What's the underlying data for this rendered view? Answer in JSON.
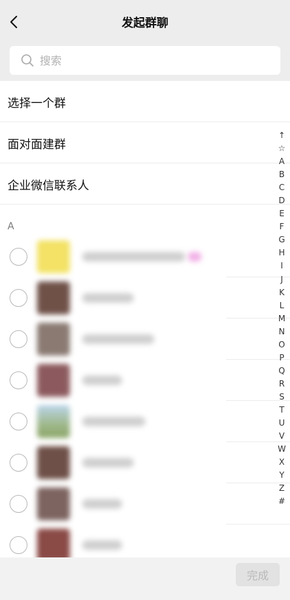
{
  "header": {
    "title": "发起群聊",
    "back_icon": "chevron-left-icon"
  },
  "search": {
    "placeholder": "搜索",
    "value": "",
    "icon": "search-icon"
  },
  "menu": [
    {
      "label": "选择一个群"
    },
    {
      "label": "面对面建群"
    },
    {
      "label": "企业微信联系人"
    }
  ],
  "section": {
    "letter": "A"
  },
  "contacts": [
    {
      "avatar_color": "#f3e266",
      "checked": false
    },
    {
      "avatar_color": "#6f5148",
      "checked": false
    },
    {
      "avatar_color": "#8a7a72",
      "checked": false
    },
    {
      "avatar_color": "#8c5a5e",
      "checked": false
    },
    {
      "avatar_color": "#9fb88a",
      "checked": false
    },
    {
      "avatar_color": "#6e5048",
      "checked": false
    },
    {
      "avatar_color": "#7d6460",
      "checked": false
    },
    {
      "avatar_color": "#8a4a46",
      "checked": false
    }
  ],
  "index_letters": [
    "↑",
    "☆",
    "A",
    "B",
    "C",
    "D",
    "E",
    "F",
    "G",
    "H",
    "I",
    "J",
    "K",
    "L",
    "M",
    "N",
    "O",
    "P",
    "Q",
    "R",
    "S",
    "T",
    "U",
    "V",
    "W",
    "X",
    "Y",
    "Z",
    "#"
  ],
  "footer": {
    "done_label": "完成"
  },
  "colors": {
    "background": "#ededed",
    "done_disabled_bg": "#e2e2e2",
    "done_disabled_text": "#b9b9b9"
  }
}
